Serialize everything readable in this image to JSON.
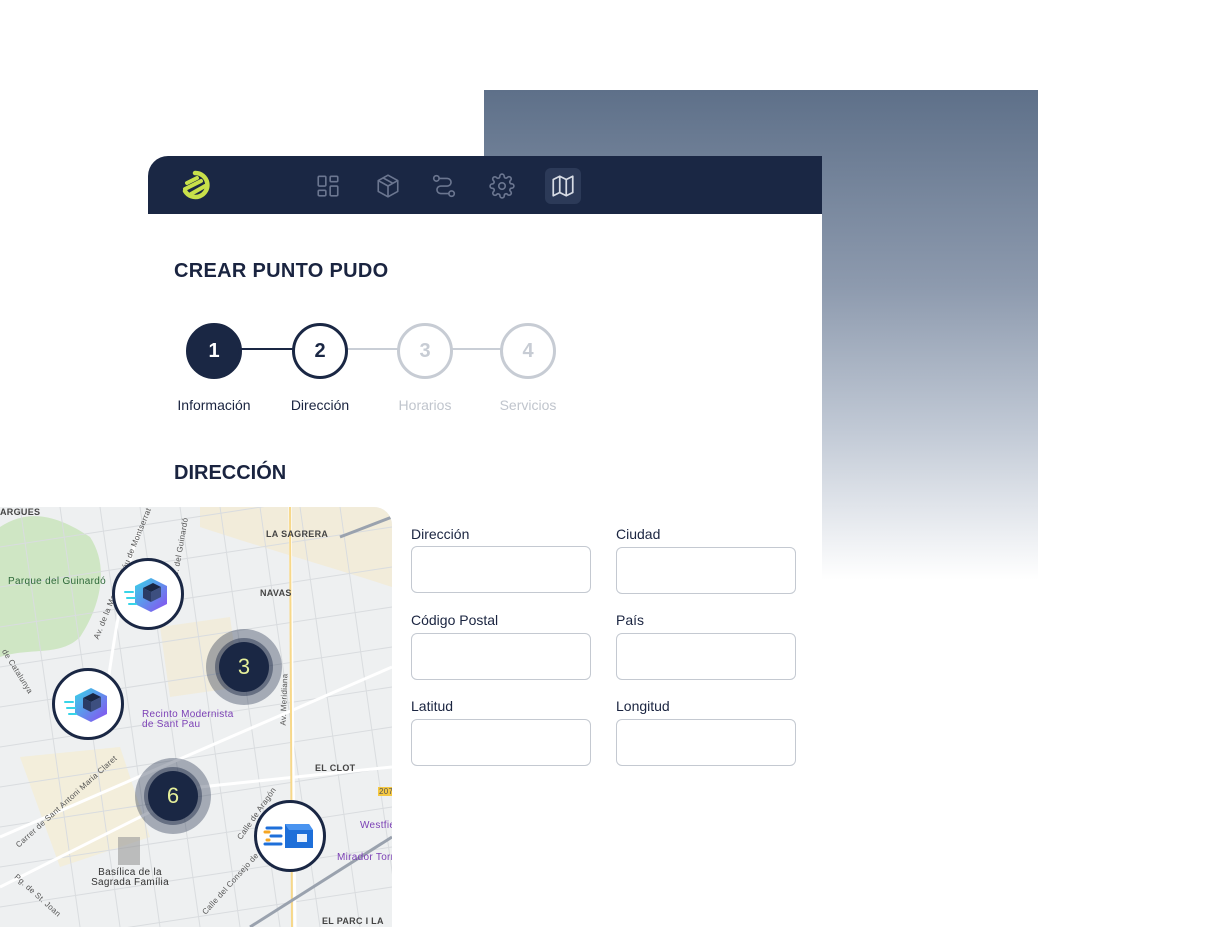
{
  "nav": {
    "items": [
      {
        "name": "dashboard-icon",
        "active": false
      },
      {
        "name": "package-icon",
        "active": false
      },
      {
        "name": "route-icon",
        "active": false
      },
      {
        "name": "gear-icon",
        "active": false
      },
      {
        "name": "map-icon",
        "active": true
      }
    ]
  },
  "page": {
    "title": "CREAR PUNTO PUDO"
  },
  "steps": [
    {
      "number": "1",
      "label": "Información",
      "state": "completed"
    },
    {
      "number": "2",
      "label": "Dirección",
      "state": "current"
    },
    {
      "number": "3",
      "label": "Horarios",
      "state": "pending"
    },
    {
      "number": "4",
      "label": "Servicios",
      "state": "pending"
    }
  ],
  "section": {
    "title": "DIRECCIÓN"
  },
  "form": {
    "direccion": {
      "label": "Dirección",
      "value": "",
      "placeholder": ""
    },
    "ciudad": {
      "label": "Ciudad",
      "value": "",
      "placeholder": ""
    },
    "codigo_postal": {
      "label": "Código Postal",
      "value": "",
      "placeholder": ""
    },
    "pais": {
      "label": "País",
      "value": "",
      "placeholder": ""
    },
    "latitud": {
      "label": "Latitud",
      "value": "",
      "placeholder": ""
    },
    "longitud": {
      "label": "Longitud",
      "value": "",
      "placeholder": ""
    }
  },
  "map": {
    "labels": {
      "argues": "ARGUES",
      "la_sagrera": "LA SAGRERA",
      "navas": "NAVAS",
      "el_clot": "EL CLOT",
      "el_parc": "EL PARC I LA",
      "parque": "Parque del Guinardó",
      "recinto": "Recinto Modernista de Sant Pau",
      "basilica": "Basílica de la Sagrada Família",
      "westfield": "Westfie",
      "mirador": "Mirador Torr",
      "av_meridiana": "Av. Meridiana",
      "calle_aragon": "Calle de Aragón",
      "av_mare": "Av. de la Mare de Déu de Montserrat",
      "carrer_claret": "Carrer de Sant Antoni Maria Claret",
      "calle_consejo": "Calle del Consejo de Ciento",
      "pg_st_joan": "Pg. de St. Joan",
      "guinardo": "C. del Guinardó",
      "catalunya": "de Catalunya",
      "road_207": "207"
    },
    "clusters": [
      {
        "count": "3"
      },
      {
        "count": "6"
      }
    ],
    "markers": [
      "pudo-marker-purple",
      "pudo-marker-purple",
      "pudo-marker-blue"
    ]
  },
  "colors": {
    "navbar": "#1a2744",
    "accent": "#c8e04a",
    "step_active": "#1a2744",
    "step_inactive": "#c7ccd4"
  }
}
